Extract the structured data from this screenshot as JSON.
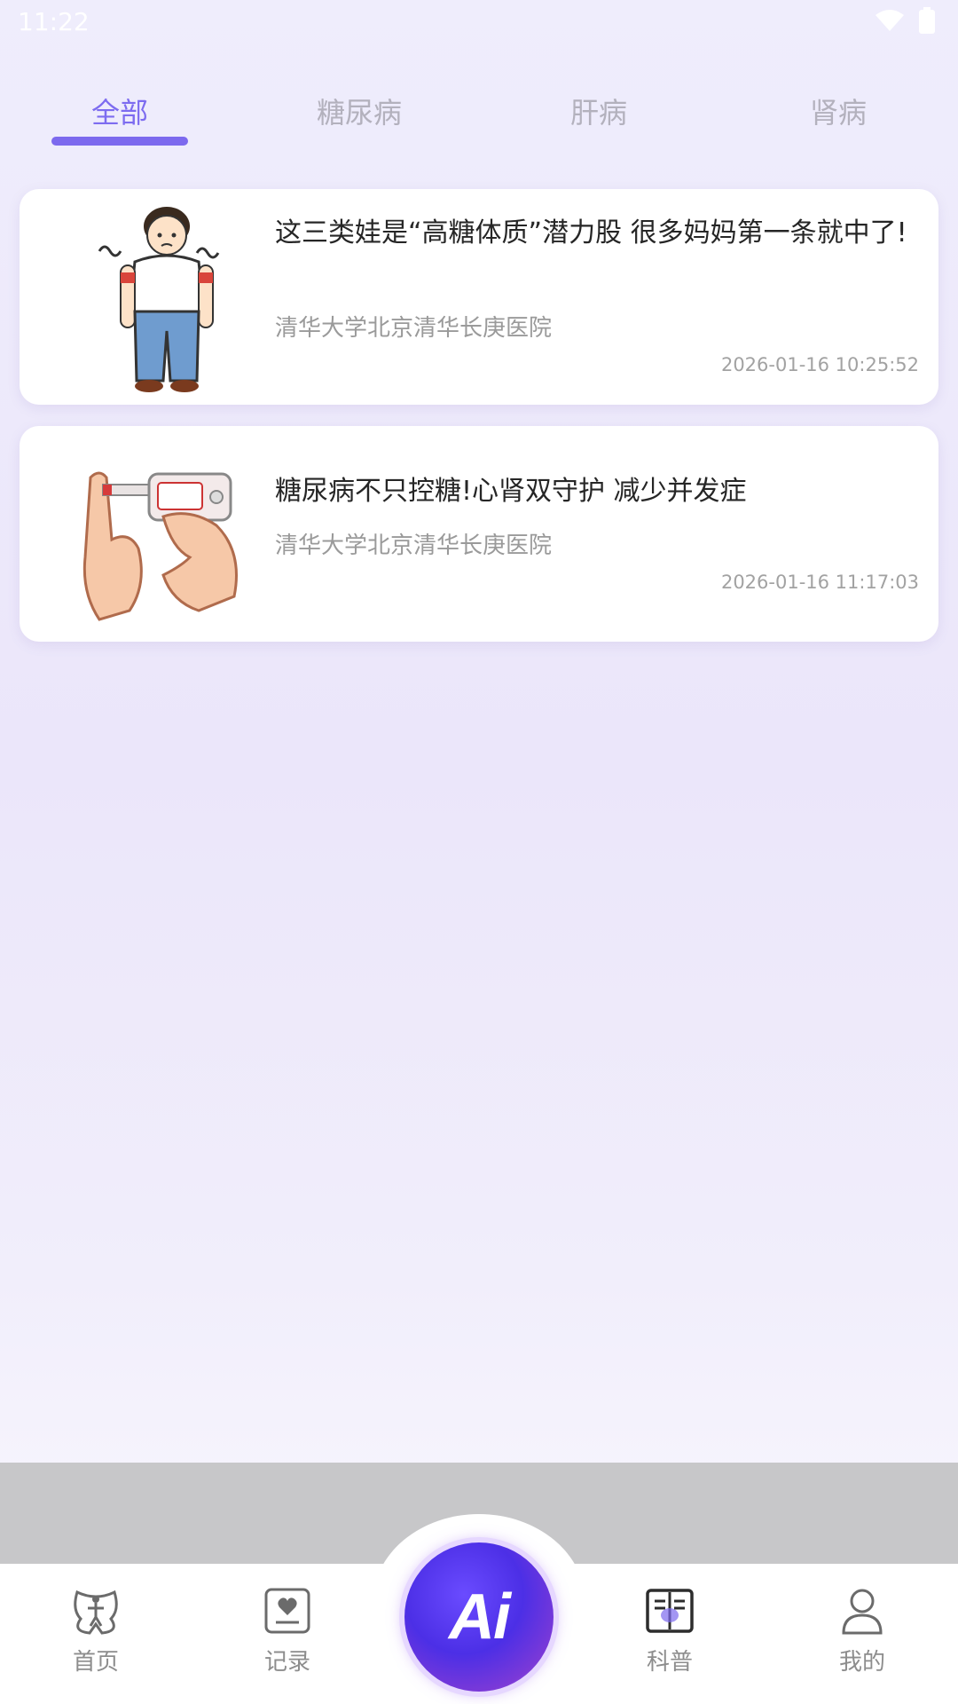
{
  "status_bar": {
    "time": "11:22"
  },
  "tabs": [
    {
      "label": "全部",
      "active": true
    },
    {
      "label": "糖尿病",
      "active": false
    },
    {
      "label": "肝病",
      "active": false
    },
    {
      "label": "肾病",
      "active": false
    }
  ],
  "articles": [
    {
      "title": "这三类娃是“高糖体质”潜力股 很多妈妈第一条就中了!",
      "source": "清华大学北京清华长庚医院",
      "date": "2026-01-16 10:25:52",
      "thumb_icon": "cartoon-boy-illustration"
    },
    {
      "title": "糖尿病不只控糖!心肾双守护 减少并发症",
      "source": "清华大学北京清华长庚医院",
      "date": "2026-01-16 11:17:03",
      "thumb_icon": "glucose-meter-illustration"
    }
  ],
  "bottom_nav": {
    "items": [
      {
        "label": "首页",
        "icon": "home-body-icon",
        "active": false
      },
      {
        "label": "记录",
        "icon": "record-icon",
        "active": false
      },
      {
        "label": "科普",
        "icon": "book-icon",
        "active": true
      },
      {
        "label": "我的",
        "icon": "profile-icon",
        "active": false
      }
    ],
    "ai_button_label": "Ai"
  },
  "colors": {
    "accent": "#7c69ee",
    "inactive_tab": "#b3b1bd",
    "background": "#eeeafb"
  }
}
